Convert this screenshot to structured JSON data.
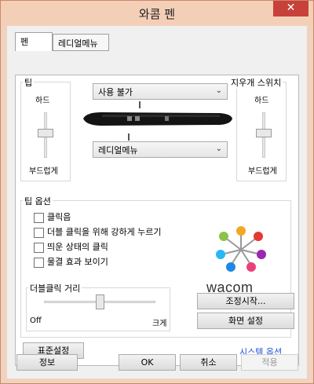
{
  "window": {
    "title": "와콤 펜",
    "close_glyph": "✕"
  },
  "tabs": [
    {
      "label": "펜"
    },
    {
      "label": "레디얼메뉴"
    }
  ],
  "tip": {
    "label": "팁",
    "firm": "하드",
    "soft": "부드럽게"
  },
  "eraser": {
    "label": "지우개 스위치",
    "firm": "하드",
    "soft": "부드럽게"
  },
  "side_switch": {
    "upper_value": "사용 불가",
    "lower_value": "레디얼메뉴"
  },
  "tip_options": {
    "label": "팁 옵션",
    "checkboxes": [
      {
        "label": "클릭음",
        "checked": false
      },
      {
        "label": "더블 클릭을 위해 강하게 누르기",
        "checked": false
      },
      {
        "label": "띄운 상태의 클릭",
        "checked": false
      },
      {
        "label": "물결 효과 보이기",
        "checked": false
      }
    ],
    "logo_text": "wacom"
  },
  "double_click": {
    "label": "더블클릭 거리",
    "min": "Off",
    "max": "크게",
    "level": 0.5
  },
  "buttons": {
    "calibrate": "조정시작...",
    "screen_settings": "화면 설정",
    "default": "표준설정",
    "system_options": "시스템 옵션",
    "about": "정보",
    "ok": "OK",
    "cancel": "취소",
    "apply": "적용"
  }
}
